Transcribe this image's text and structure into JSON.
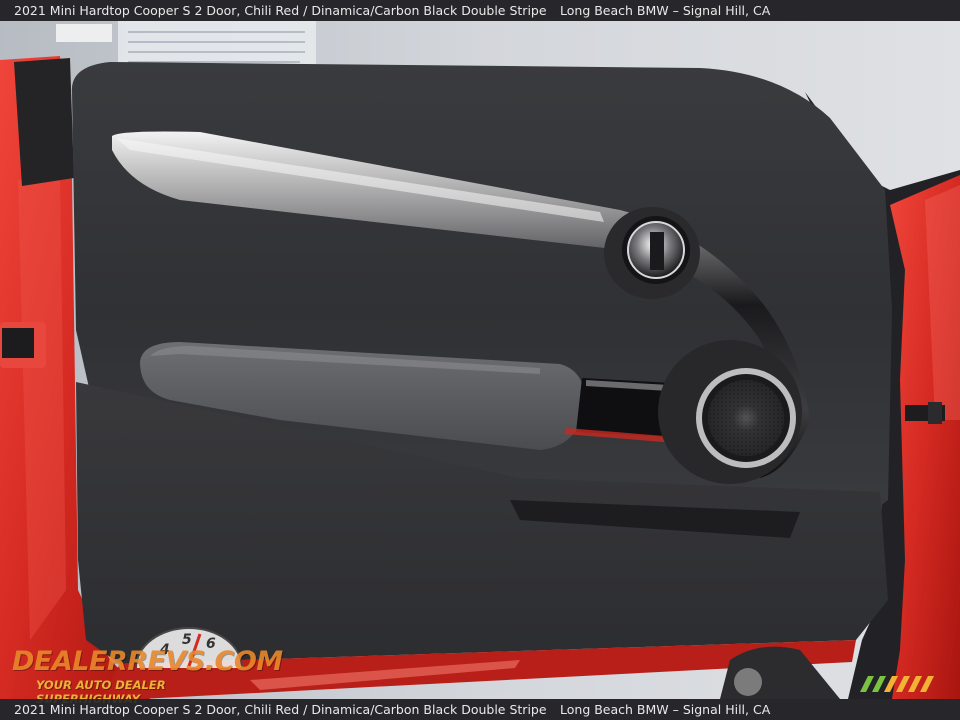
{
  "caption": {
    "vehicle": "2021 Mini Hardtop Cooper S 2 Door,   Chili Red / Dinamica/Carbon Black Double Stripe",
    "dealer": "Long Beach BMW – Signal Hill, CA"
  },
  "watermark": {
    "name": "DEALERREVS.COM",
    "tagline": "YOUR AUTO DEALER SUPERHIGHWAY",
    "dial_digits": [
      "4",
      "5",
      "6"
    ]
  },
  "icons": {
    "door_lock": "door-lock-knob-icon",
    "speaker": "speaker-grille-icon",
    "mirror": "side-mirror-icon",
    "dealer_badge": "dealer-badge-icon"
  },
  "colors": {
    "body_paint": "#d92b22",
    "door_panel": "#2f3033",
    "armrest": "#5c5d61",
    "caption_bar": "#28282c"
  }
}
